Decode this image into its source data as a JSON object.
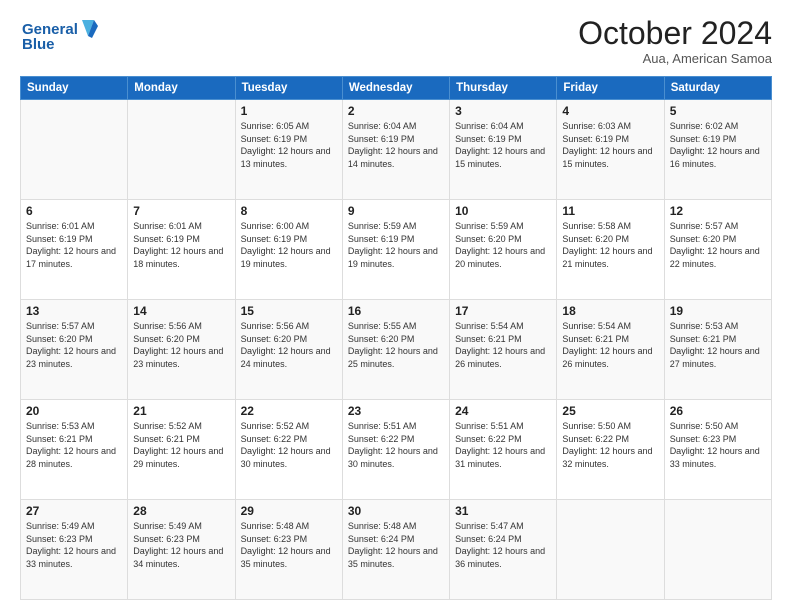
{
  "header": {
    "logo_line1": "General",
    "logo_line2": "Blue",
    "month": "October 2024",
    "location": "Aua, American Samoa"
  },
  "weekdays": [
    "Sunday",
    "Monday",
    "Tuesday",
    "Wednesday",
    "Thursday",
    "Friday",
    "Saturday"
  ],
  "weeks": [
    [
      {
        "day": "",
        "info": ""
      },
      {
        "day": "",
        "info": ""
      },
      {
        "day": "1",
        "info": "Sunrise: 6:05 AM\nSunset: 6:19 PM\nDaylight: 12 hours and 13 minutes."
      },
      {
        "day": "2",
        "info": "Sunrise: 6:04 AM\nSunset: 6:19 PM\nDaylight: 12 hours and 14 minutes."
      },
      {
        "day": "3",
        "info": "Sunrise: 6:04 AM\nSunset: 6:19 PM\nDaylight: 12 hours and 15 minutes."
      },
      {
        "day": "4",
        "info": "Sunrise: 6:03 AM\nSunset: 6:19 PM\nDaylight: 12 hours and 15 minutes."
      },
      {
        "day": "5",
        "info": "Sunrise: 6:02 AM\nSunset: 6:19 PM\nDaylight: 12 hours and 16 minutes."
      }
    ],
    [
      {
        "day": "6",
        "info": "Sunrise: 6:01 AM\nSunset: 6:19 PM\nDaylight: 12 hours and 17 minutes."
      },
      {
        "day": "7",
        "info": "Sunrise: 6:01 AM\nSunset: 6:19 PM\nDaylight: 12 hours and 18 minutes."
      },
      {
        "day": "8",
        "info": "Sunrise: 6:00 AM\nSunset: 6:19 PM\nDaylight: 12 hours and 19 minutes."
      },
      {
        "day": "9",
        "info": "Sunrise: 5:59 AM\nSunset: 6:19 PM\nDaylight: 12 hours and 19 minutes."
      },
      {
        "day": "10",
        "info": "Sunrise: 5:59 AM\nSunset: 6:20 PM\nDaylight: 12 hours and 20 minutes."
      },
      {
        "day": "11",
        "info": "Sunrise: 5:58 AM\nSunset: 6:20 PM\nDaylight: 12 hours and 21 minutes."
      },
      {
        "day": "12",
        "info": "Sunrise: 5:57 AM\nSunset: 6:20 PM\nDaylight: 12 hours and 22 minutes."
      }
    ],
    [
      {
        "day": "13",
        "info": "Sunrise: 5:57 AM\nSunset: 6:20 PM\nDaylight: 12 hours and 23 minutes."
      },
      {
        "day": "14",
        "info": "Sunrise: 5:56 AM\nSunset: 6:20 PM\nDaylight: 12 hours and 23 minutes."
      },
      {
        "day": "15",
        "info": "Sunrise: 5:56 AM\nSunset: 6:20 PM\nDaylight: 12 hours and 24 minutes."
      },
      {
        "day": "16",
        "info": "Sunrise: 5:55 AM\nSunset: 6:20 PM\nDaylight: 12 hours and 25 minutes."
      },
      {
        "day": "17",
        "info": "Sunrise: 5:54 AM\nSunset: 6:21 PM\nDaylight: 12 hours and 26 minutes."
      },
      {
        "day": "18",
        "info": "Sunrise: 5:54 AM\nSunset: 6:21 PM\nDaylight: 12 hours and 26 minutes."
      },
      {
        "day": "19",
        "info": "Sunrise: 5:53 AM\nSunset: 6:21 PM\nDaylight: 12 hours and 27 minutes."
      }
    ],
    [
      {
        "day": "20",
        "info": "Sunrise: 5:53 AM\nSunset: 6:21 PM\nDaylight: 12 hours and 28 minutes."
      },
      {
        "day": "21",
        "info": "Sunrise: 5:52 AM\nSunset: 6:21 PM\nDaylight: 12 hours and 29 minutes."
      },
      {
        "day": "22",
        "info": "Sunrise: 5:52 AM\nSunset: 6:22 PM\nDaylight: 12 hours and 30 minutes."
      },
      {
        "day": "23",
        "info": "Sunrise: 5:51 AM\nSunset: 6:22 PM\nDaylight: 12 hours and 30 minutes."
      },
      {
        "day": "24",
        "info": "Sunrise: 5:51 AM\nSunset: 6:22 PM\nDaylight: 12 hours and 31 minutes."
      },
      {
        "day": "25",
        "info": "Sunrise: 5:50 AM\nSunset: 6:22 PM\nDaylight: 12 hours and 32 minutes."
      },
      {
        "day": "26",
        "info": "Sunrise: 5:50 AM\nSunset: 6:23 PM\nDaylight: 12 hours and 33 minutes."
      }
    ],
    [
      {
        "day": "27",
        "info": "Sunrise: 5:49 AM\nSunset: 6:23 PM\nDaylight: 12 hours and 33 minutes."
      },
      {
        "day": "28",
        "info": "Sunrise: 5:49 AM\nSunset: 6:23 PM\nDaylight: 12 hours and 34 minutes."
      },
      {
        "day": "29",
        "info": "Sunrise: 5:48 AM\nSunset: 6:23 PM\nDaylight: 12 hours and 35 minutes."
      },
      {
        "day": "30",
        "info": "Sunrise: 5:48 AM\nSunset: 6:24 PM\nDaylight: 12 hours and 35 minutes."
      },
      {
        "day": "31",
        "info": "Sunrise: 5:47 AM\nSunset: 6:24 PM\nDaylight: 12 hours and 36 minutes."
      },
      {
        "day": "",
        "info": ""
      },
      {
        "day": "",
        "info": ""
      }
    ]
  ]
}
